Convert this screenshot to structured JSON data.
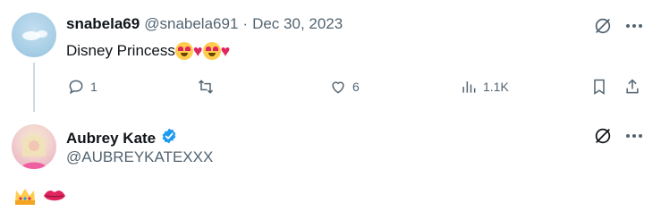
{
  "tweet1": {
    "display_name": "snabela69",
    "handle": "@snabela691",
    "separator": "·",
    "date": "Dec 30, 2023",
    "text": "Disney Princess",
    "actions": {
      "replies": "1",
      "likes": "6",
      "views": "1.1K"
    }
  },
  "tweet2": {
    "display_name": "Aubrey Kate",
    "handle": "@AUBREYKATEXXX"
  },
  "colors": {
    "verified": "#1d9bf0",
    "muted": "#536471",
    "heart": "#e0245e"
  },
  "icons": [
    "grok-icon",
    "more-icon",
    "reply-icon",
    "retweet-icon",
    "like-icon",
    "views-icon",
    "bookmark-icon",
    "share-icon",
    "verified-badge-icon",
    "crown-emoji",
    "kiss-lips-emoji"
  ]
}
